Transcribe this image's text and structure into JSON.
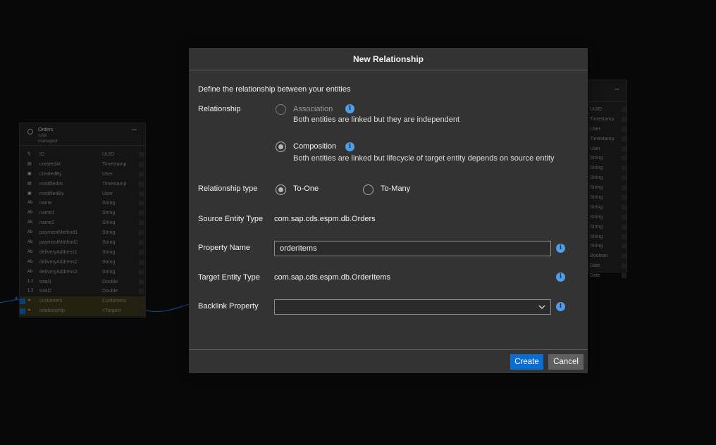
{
  "dialog": {
    "title": "New Relationship",
    "intro": "Define the relationship between your entities",
    "relationship": {
      "label": "Relationship",
      "options": [
        {
          "name": "Association",
          "description": "Both entities are linked but they are independent",
          "checked": false,
          "disabled": true
        },
        {
          "name": "Composition",
          "description": "Both entities are linked but lifecycle of target entity depends on source entity",
          "checked": true,
          "disabled": false
        }
      ]
    },
    "relationship_type": {
      "label": "Relationship type",
      "options": [
        {
          "name": "To-One",
          "checked": true
        },
        {
          "name": "To-Many",
          "checked": false
        }
      ]
    },
    "source_entity_type": {
      "label": "Source Entity Type",
      "value": "com.sap.cds.espm.db.Orders"
    },
    "property_name": {
      "label": "Property Name",
      "value": "orderItems"
    },
    "target_entity_type": {
      "label": "Target Entity Type",
      "value": "com.sap.cds.espm.db.OrderItems"
    },
    "backlink_property": {
      "label": "Backlink Property",
      "value": ""
    },
    "buttons": {
      "create": "Create",
      "cancel": "Cancel"
    }
  },
  "background": {
    "orders_entity": {
      "name": "Orders",
      "aspects": [
        "cuid",
        "managed"
      ],
      "rows": [
        {
          "icon": "key",
          "name": "ID",
          "type": "UUID"
        },
        {
          "icon": "timestamp",
          "name": "createdAt",
          "type": "Timestamp"
        },
        {
          "icon": "user",
          "name": "createdBy",
          "type": "User"
        },
        {
          "icon": "timestamp",
          "name": "modifiedAt",
          "type": "Timestamp"
        },
        {
          "icon": "user",
          "name": "modifiedBy",
          "type": "User"
        },
        {
          "icon": "Ab",
          "name": "name",
          "type": "String"
        },
        {
          "icon": "Ab",
          "name": "name1",
          "type": "String"
        },
        {
          "icon": "Ab",
          "name": "name2",
          "type": "String"
        },
        {
          "icon": "Ab",
          "name": "paymentMethod1",
          "type": "String"
        },
        {
          "icon": "Ab",
          "name": "paymentMethod2",
          "type": "String"
        },
        {
          "icon": "Ab",
          "name": "deliveryAddress1",
          "type": "String"
        },
        {
          "icon": "Ab",
          "name": "deliveryAddress2",
          "type": "String"
        },
        {
          "icon": "Ab",
          "name": "deliveryAddress3",
          "type": "String"
        },
        {
          "icon": "1.2",
          "name": "total1",
          "type": "Double"
        },
        {
          "icon": "1.2",
          "name": "total2",
          "type": "Double"
        },
        {
          "icon": "link",
          "name": "customers",
          "type": "Customers"
        },
        {
          "icon": "link",
          "name": "relationship",
          "type": "<Target>"
        }
      ]
    },
    "right_entity_types": [
      "UUID",
      "Timestamp",
      "User",
      "Timestamp",
      "User",
      "String",
      "String",
      "String",
      "String",
      "String",
      "String",
      "String",
      "String",
      "String",
      "String",
      "Boolean",
      "Date",
      "Date"
    ]
  }
}
